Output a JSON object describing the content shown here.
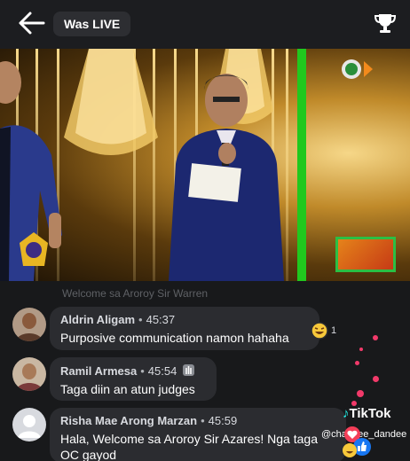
{
  "header": {
    "title": "Was LIVE",
    "back_icon": "arrow-left-icon",
    "trophy_icon": "trophy-icon"
  },
  "faded_comment": "Welcome sa Aroroy Sir Warren",
  "comments": [
    {
      "name": "Aldrin Aligam",
      "time": "45:37",
      "text": "Purposive communication namon hahaha",
      "reaction_count": "1"
    },
    {
      "name": "Ramil Armesa",
      "time": "45:54",
      "text": "Taga diin an atun judges"
    },
    {
      "name": "Risha Mae Arong Marzan",
      "time": "45:59",
      "text": "Hala, Welcome sa Aroroy Sir Azares! Nga taga OC gayod"
    }
  ],
  "watermark": {
    "brand": "TikTok",
    "handle": "@chandee_dandee"
  },
  "colors": {
    "accent_green": "#21c81e",
    "bubble": "#2b2c30",
    "background": "#18191b"
  }
}
